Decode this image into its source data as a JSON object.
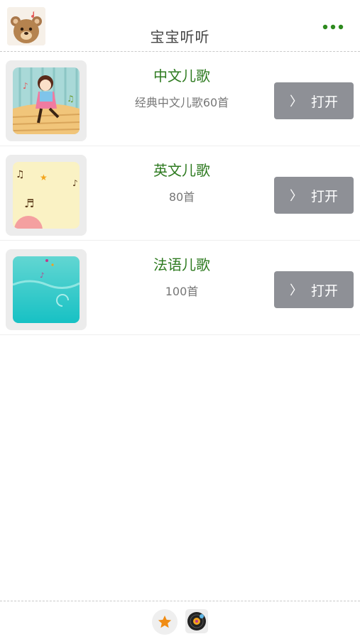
{
  "header": {
    "title": "宝宝听听",
    "logo_icon": "bear-icon",
    "more_icon": "more-dots-icon",
    "accent": "#2d8a1e"
  },
  "list": [
    {
      "title": "中文儿歌",
      "subtitle": "经典中文儿歌60首",
      "button_label": "打开",
      "thumbnail": "dancing-girl-thumbnail"
    },
    {
      "title": "英文儿歌",
      "subtitle": "80首",
      "button_label": "打开",
      "thumbnail": "music-notes-thumbnail"
    },
    {
      "title": "法语儿歌",
      "subtitle": "100首",
      "button_label": "打开",
      "thumbnail": "aqua-waves-thumbnail"
    }
  ],
  "footer": {
    "favorite_icon": "star-icon",
    "player_icon": "vinyl-disc-icon"
  },
  "colors": {
    "title_green": "#2d7a1f",
    "button_gray": "#8e9096"
  }
}
